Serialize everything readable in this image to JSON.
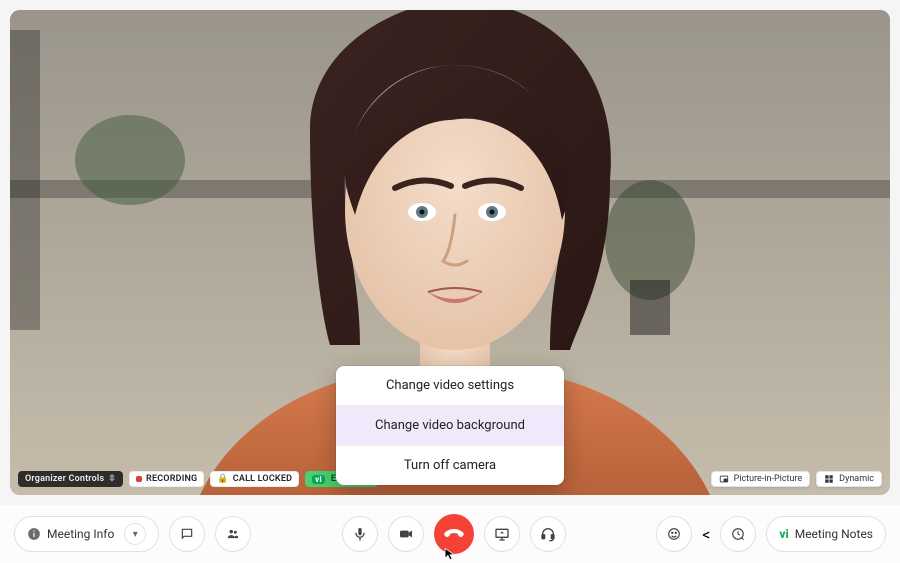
{
  "status": {
    "organizer_controls": "Organizer Controls",
    "recording": "RECORDING",
    "call_locked": "CALL LOCKED",
    "enabled": "ENABLED"
  },
  "views": {
    "pip": "Picture-in-Picture",
    "dynamic": "Dynamic"
  },
  "popup": {
    "item1": "Change video settings",
    "item2": "Change video background",
    "item3": "Turn off camera"
  },
  "toolbar": {
    "meeting_info": "Meeting Info",
    "meeting_notes": "Meeting Notes",
    "vi": "vi"
  },
  "icons": {
    "info": "info-icon",
    "chevron_down": "chevron-down-icon",
    "chat": "chat-icon",
    "people": "people-icon",
    "mic": "mic-icon",
    "camera": "camera-icon",
    "hangup": "hangup-icon",
    "present": "present-icon",
    "headset": "headset-icon",
    "emoji": "emoji-icon",
    "poll": "poll-icon",
    "pip": "pip-icon",
    "grid": "grid-icon",
    "lock": "lock-icon",
    "record": "record-icon",
    "vi_badge": "vi-badge-icon"
  }
}
